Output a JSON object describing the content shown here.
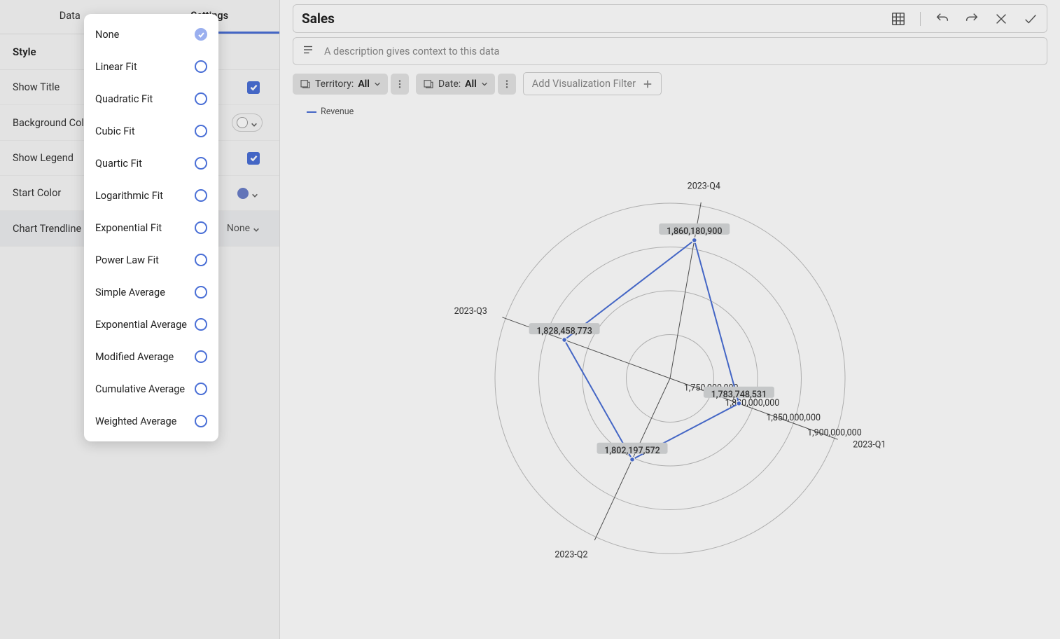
{
  "tabs": {
    "data": "Data",
    "settings": "Settings"
  },
  "section": {
    "style": "Style"
  },
  "rows": {
    "show_title": "Show Title",
    "background_color": "Background Color",
    "show_legend": "Show Legend",
    "start_color": "Start Color",
    "chart_trendline": "Chart Trendline",
    "trendline_value": "None"
  },
  "dropdown": {
    "none": "None",
    "linear": "Linear Fit",
    "quadratic": "Quadratic Fit",
    "cubic": "Cubic Fit",
    "quartic": "Quartic Fit",
    "logarithmic": "Logarithmic Fit",
    "exponential": "Exponential Fit",
    "power": "Power Law Fit",
    "simple_avg": "Simple Average",
    "exp_avg": "Exponential Average",
    "mod_avg": "Modified Average",
    "cum_avg": "Cumulative Average",
    "wgt_avg": "Weighted Average"
  },
  "title": "Sales",
  "description_placeholder": "A description gives context to this data",
  "filters": {
    "territory_label": "Territory:",
    "territory_value": "All",
    "date_label": "Date:",
    "date_value": "All",
    "add": "Add Visualization Filter"
  },
  "legend": {
    "revenue": "Revenue"
  },
  "chart_data": {
    "type": "radar",
    "categories": [
      "2023-Q1",
      "2023-Q2",
      "2023-Q3",
      "2023-Q4"
    ],
    "series": [
      {
        "name": "Revenue",
        "values": [
          1783748531,
          1802197572,
          1828458773,
          1860180900
        ]
      }
    ],
    "axis_ticks": [
      1750000000,
      1800000000,
      1850000000,
      1900000000
    ],
    "axis_tick_labels": [
      "1,750,000,000",
      "1,800,000,000",
      "1,850,000,000",
      "1,900,000,000"
    ],
    "data_labels": [
      "1,783,748,531",
      "1,802,197,572",
      "1,828,458,773",
      "1,860,180,900"
    ],
    "radial_min": 1700000000,
    "radial_max": 1900000000
  }
}
